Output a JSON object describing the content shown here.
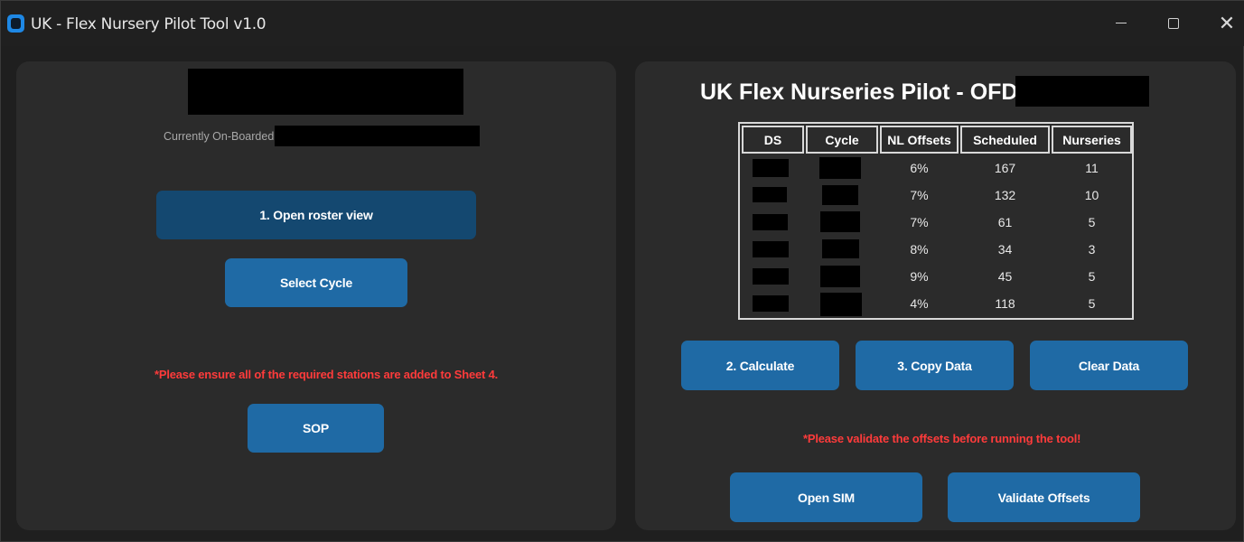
{
  "window": {
    "title": "UK - Flex Nursery Pilot Tool v1.0",
    "controls": {
      "minimize": "",
      "maximize": "",
      "close": "✕"
    }
  },
  "left_panel": {
    "onboarded_label": "Currently On-Boarded:",
    "open_roster_button": "1. Open roster view",
    "select_cycle_button": "Select Cycle",
    "warning": "*Please ensure all of the required stations are added to Sheet 4.",
    "sop_button": "SOP"
  },
  "right_panel": {
    "heading": "UK Flex Nurseries Pilot - OFD",
    "table": {
      "headers": [
        "DS",
        "Cycle",
        "NL Offsets",
        "Scheduled",
        "Nurseries"
      ],
      "rows": [
        {
          "nl_offsets": "6%",
          "scheduled": "167",
          "nurseries": "11"
        },
        {
          "nl_offsets": "7%",
          "scheduled": "132",
          "nurseries": "10"
        },
        {
          "nl_offsets": "7%",
          "scheduled": "61",
          "nurseries": "5"
        },
        {
          "nl_offsets": "8%",
          "scheduled": "34",
          "nurseries": "3"
        },
        {
          "nl_offsets": "9%",
          "scheduled": "45",
          "nurseries": "5"
        },
        {
          "nl_offsets": "4%",
          "scheduled": "118",
          "nurseries": "5"
        }
      ]
    },
    "calculate_button": "2. Calculate",
    "copy_data_button": "3. Copy Data",
    "clear_data_button": "Clear Data",
    "warning": "*Please validate the offsets before running the tool!",
    "open_sim_button": "Open SIM",
    "validate_offsets_button": "Validate Offsets"
  },
  "colors": {
    "button": "#1f6aa5",
    "button_dark": "#144870",
    "warning": "#ff3b3b",
    "panel": "#2b2b2b",
    "background": "#1f1f1f"
  }
}
